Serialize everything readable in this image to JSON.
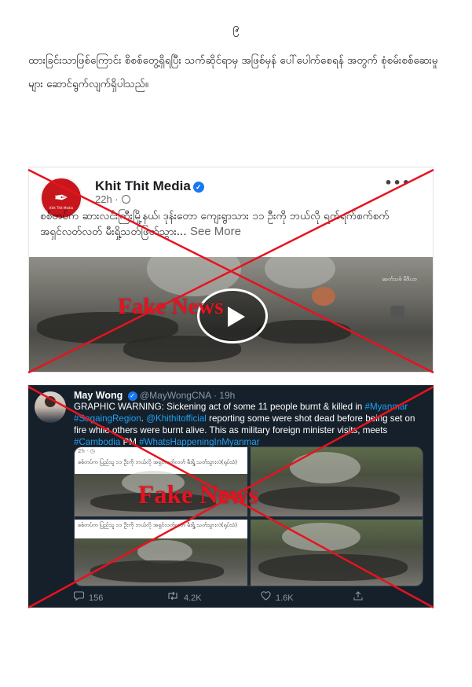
{
  "page": {
    "number": "၉",
    "intro": "ထားခြင်းသာဖြစ်ကြောင်း စိစစ်တွေ့ရှိရပြီး သက်ဆိုင်ရာမှ အဖြစ်မှန် ပေါ်ပေါက်စေရန် အတွက် စုံစမ်းစစ်ဆေးမှုများ ဆောင်ရွက်လျက်ရှိပါသည်။"
  },
  "post1": {
    "page_name": "Khit Thit Media",
    "time": "22h ·",
    "body": "စစ်တပ်က ဆားလင်းကြီးမြို့နယ်၊ ဒုန်းတော ကျေးရွာသား ၁၁ ဦးကို ဘယ်လို ရက်ရက်စက်စက် အရှင်လတ်လတ် မီးရှို့သတ်ဖြတ်သွား...",
    "see_more": "See More",
    "more_menu": "•••",
    "avatar_glyph": "✒",
    "avatar_text": "Khit Thit Media",
    "watermark": "ခေတ်သစ် မီဒီယာ",
    "overlay_text": "Fake News"
  },
  "post2": {
    "display_name": "May Wong",
    "handle_time": "@MayWongCNA · 19h",
    "text_1": "GRAPHIC WARNING: Sickening act of some 11 people burnt & killed in",
    "hashtag_myanmar": "#Myanmar",
    "hashtag_sagaing": "#SagaingRegion",
    "text_2": ". ",
    "mention": "@Khithitofficial",
    "text_3": " reporting some were shot dead before being set on fire while others were burnt alive. This as military foreign minister visits, meets ",
    "hashtag_cambodia": "#Cambodia",
    "text_4": " PM ",
    "hashtag_whats": "#WhatsHappeningInMyanmar",
    "media_caption": "စစ်တပ်က ပြည်သူ ၁၁ ဦးကို ဘယ်လို အရှင်လတ်လတ် မီးရှို့ သတ်သွားလဲ(ရုပ်သံ)",
    "media_time": "2h · ◷",
    "reply_count": "156",
    "retweet_count": "4.2K",
    "like_count": "1.6K",
    "overlay_text": "Fake News"
  },
  "icons": {
    "reply": "reply-icon",
    "retweet": "retweet-icon",
    "like": "heart-icon",
    "share": "share-icon"
  },
  "colors": {
    "cross": "#e8121e",
    "twitter_bg": "#15202b",
    "twitter_link": "#1da1f2",
    "facebook_blue": "#1877f2"
  }
}
